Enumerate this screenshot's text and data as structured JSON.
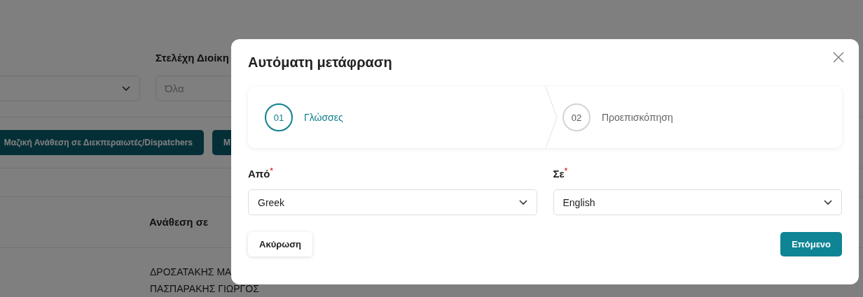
{
  "background": {
    "filter_label": "Στελέχη Διοίκη",
    "filter_placeholder": "Όλα",
    "buttons": [
      "Μαζική Ανάθεση σε Διεκπεραιωτές/Dispatchers",
      "Μ"
    ],
    "column_header": "Ανάθεση σε",
    "column_1_cells": [
      "ΔΡΟΣΑΤΑΚΗΣ ΜΑ",
      "ΠΑΣΠΑΡΑΚΗΣ ΓΙΩΡΓΟΣ"
    ]
  },
  "dialog": {
    "title": "Αυτόματη μετάφραση",
    "steps": [
      {
        "number": "01",
        "label": "Γλώσσες",
        "selected": true
      },
      {
        "number": "02",
        "label": "Προεπισκόπηση",
        "selected": false
      }
    ],
    "fields": [
      {
        "label": "Από",
        "required_mark": "*",
        "value": "Greek"
      },
      {
        "label": "Σε",
        "required_mark": "*",
        "value": "English"
      }
    ],
    "cancel_button": "Ακύρωση",
    "next_button": "Επόμενο"
  }
}
